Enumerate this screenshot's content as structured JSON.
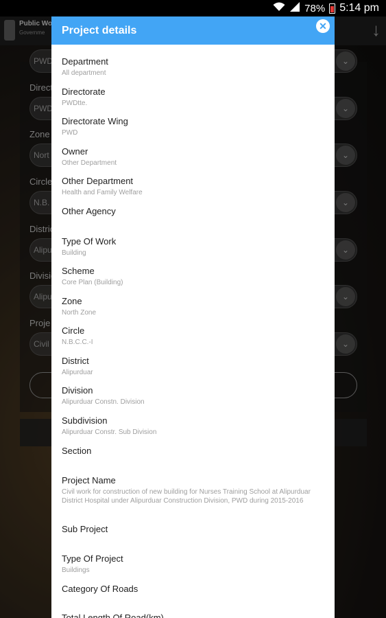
{
  "status_bar": {
    "battery": "78%",
    "time": "5:14 pm"
  },
  "background_app": {
    "title": "Public Wo",
    "subtitle": "Governme",
    "fields": [
      {
        "label": "",
        "value": "PWD"
      },
      {
        "label": "Directo",
        "value": "PWD"
      },
      {
        "label": "Zone",
        "value": "Nort"
      },
      {
        "label": "Circle",
        "value": "N.B."
      },
      {
        "label": "Distric",
        "value": "Alipu"
      },
      {
        "label": "Divisio",
        "value": "Alipu"
      },
      {
        "label": "Proje",
        "value": "Civil"
      }
    ]
  },
  "dialog": {
    "title": "Project details",
    "items": [
      {
        "label": "Department",
        "value": "All department"
      },
      {
        "label": "Directorate",
        "value": "PWDtte."
      },
      {
        "label": "Directorate Wing",
        "value": "PWD"
      },
      {
        "label": "Owner",
        "value": "Other Department"
      },
      {
        "label": "Other Department",
        "value": "Health and Family Welfare"
      },
      {
        "label": "Other Agency",
        "value": ""
      },
      {
        "label": "Type Of Work",
        "value": "Building"
      },
      {
        "label": "Scheme",
        "value": "Core Plan (Building)"
      },
      {
        "label": "Zone",
        "value": "North Zone"
      },
      {
        "label": "Circle",
        "value": "N.B.C.C.-I"
      },
      {
        "label": "District",
        "value": "Alipurduar"
      },
      {
        "label": "Division",
        "value": "Alipurduar Constn. Division"
      },
      {
        "label": "Subdivision",
        "value": "Alipurduar Constr. Sub Division"
      },
      {
        "label": "Section",
        "value": ""
      },
      {
        "label": "Project Name",
        "value": "Civil work for construction of new building for Nurses Training School at Alipurduar District Hospital under Alipurduar Construction Division, PWD during 2015-2016"
      },
      {
        "label": "Sub Project",
        "value": ""
      },
      {
        "label": "Type Of Project",
        "value": "Buildings"
      },
      {
        "label": "Category Of Roads",
        "value": ""
      },
      {
        "label": "Total Length Of Road(km)",
        "value": ""
      }
    ]
  }
}
